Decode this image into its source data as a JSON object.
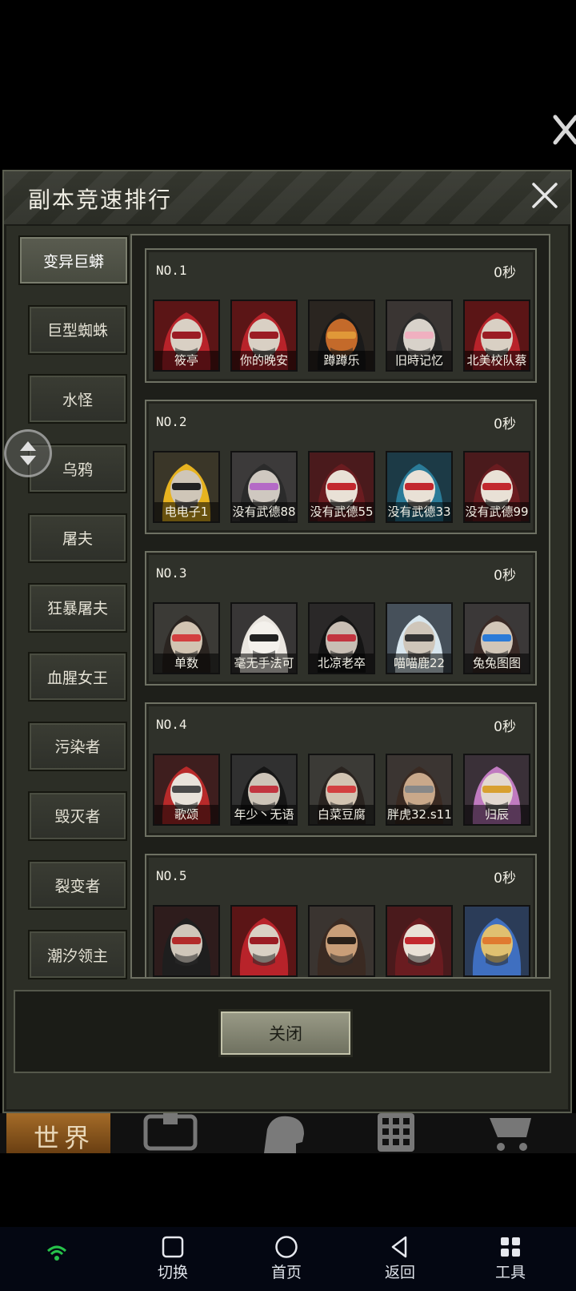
{
  "dialog": {
    "title": "副本竞速排行",
    "close_label": "关闭"
  },
  "categories": [
    {
      "label": "变异巨蟒",
      "active": true
    },
    {
      "label": "巨型蜘蛛",
      "active": false
    },
    {
      "label": "水怪",
      "active": false
    },
    {
      "label": "乌鸦",
      "active": false
    },
    {
      "label": "屠夫",
      "active": false
    },
    {
      "label": "狂暴屠夫",
      "active": false
    },
    {
      "label": "血腥女王",
      "active": false
    },
    {
      "label": "污染者",
      "active": false
    },
    {
      "label": "毁灭者",
      "active": false
    },
    {
      "label": "裂变者",
      "active": false
    },
    {
      "label": "潮汐领主",
      "active": false
    }
  ],
  "rankings": [
    {
      "rank": "NO.1",
      "time": "0秒",
      "players": [
        {
          "name": "筱亭",
          "avatar": "red-hood"
        },
        {
          "name": "你的晚安",
          "avatar": "red-hood"
        },
        {
          "name": "蹲蹲乐",
          "avatar": "crow-mask"
        },
        {
          "name": "旧時记忆",
          "avatar": "flower-crown"
        },
        {
          "name": "北美校队蔡",
          "avatar": "red-hood"
        }
      ]
    },
    {
      "rank": "NO.2",
      "time": "0秒",
      "players": [
        {
          "name": "电电子1",
          "avatar": "hard-hat"
        },
        {
          "name": "没有武德88",
          "avatar": "purple-mask"
        },
        {
          "name": "没有武德55",
          "avatar": "skull-helm"
        },
        {
          "name": "没有武德33",
          "avatar": "skull-helm-blue"
        },
        {
          "name": "没有武德99",
          "avatar": "skull-helm"
        }
      ]
    },
    {
      "rank": "NO.3",
      "time": "0秒",
      "players": [
        {
          "name": "单数",
          "avatar": "bun-glasses"
        },
        {
          "name": "毫无手法可",
          "avatar": "white-mask"
        },
        {
          "name": "北凉老卒",
          "avatar": "dark-hat"
        },
        {
          "name": "喵喵鹿22",
          "avatar": "white-cap"
        },
        {
          "name": "兔兔图图",
          "avatar": "goggles"
        }
      ]
    },
    {
      "rank": "NO.4",
      "time": "0秒",
      "players": [
        {
          "name": "歌颂",
          "avatar": "opera-crown"
        },
        {
          "name": "年少丶无语",
          "avatar": "pirate-hat"
        },
        {
          "name": "白菜豆腐",
          "avatar": "bun-glasses"
        },
        {
          "name": "胖虎32.s11",
          "avatar": "beard-glasses"
        },
        {
          "name": "归辰",
          "avatar": "pink-hair"
        }
      ]
    },
    {
      "rank": "NO.5",
      "time": "0秒",
      "players": [
        {
          "name": "",
          "avatar": "officer-cap"
        },
        {
          "name": "",
          "avatar": "red-hood"
        },
        {
          "name": "",
          "avatar": "beard"
        },
        {
          "name": "",
          "avatar": "skull-helm"
        },
        {
          "name": "",
          "avatar": "blue-beast"
        }
      ]
    }
  ],
  "game_bar": {
    "world_label": "世界",
    "icons": [
      "backpack-icon",
      "head-icon",
      "building-icon",
      "cart-icon"
    ]
  },
  "system_nav": {
    "items": [
      {
        "label": "切换",
        "icon": "square-icon"
      },
      {
        "label": "首页",
        "icon": "circle-icon"
      },
      {
        "label": "返回",
        "icon": "back-triangle-icon"
      },
      {
        "label": "工具",
        "icon": "grid-icon"
      }
    ]
  }
}
